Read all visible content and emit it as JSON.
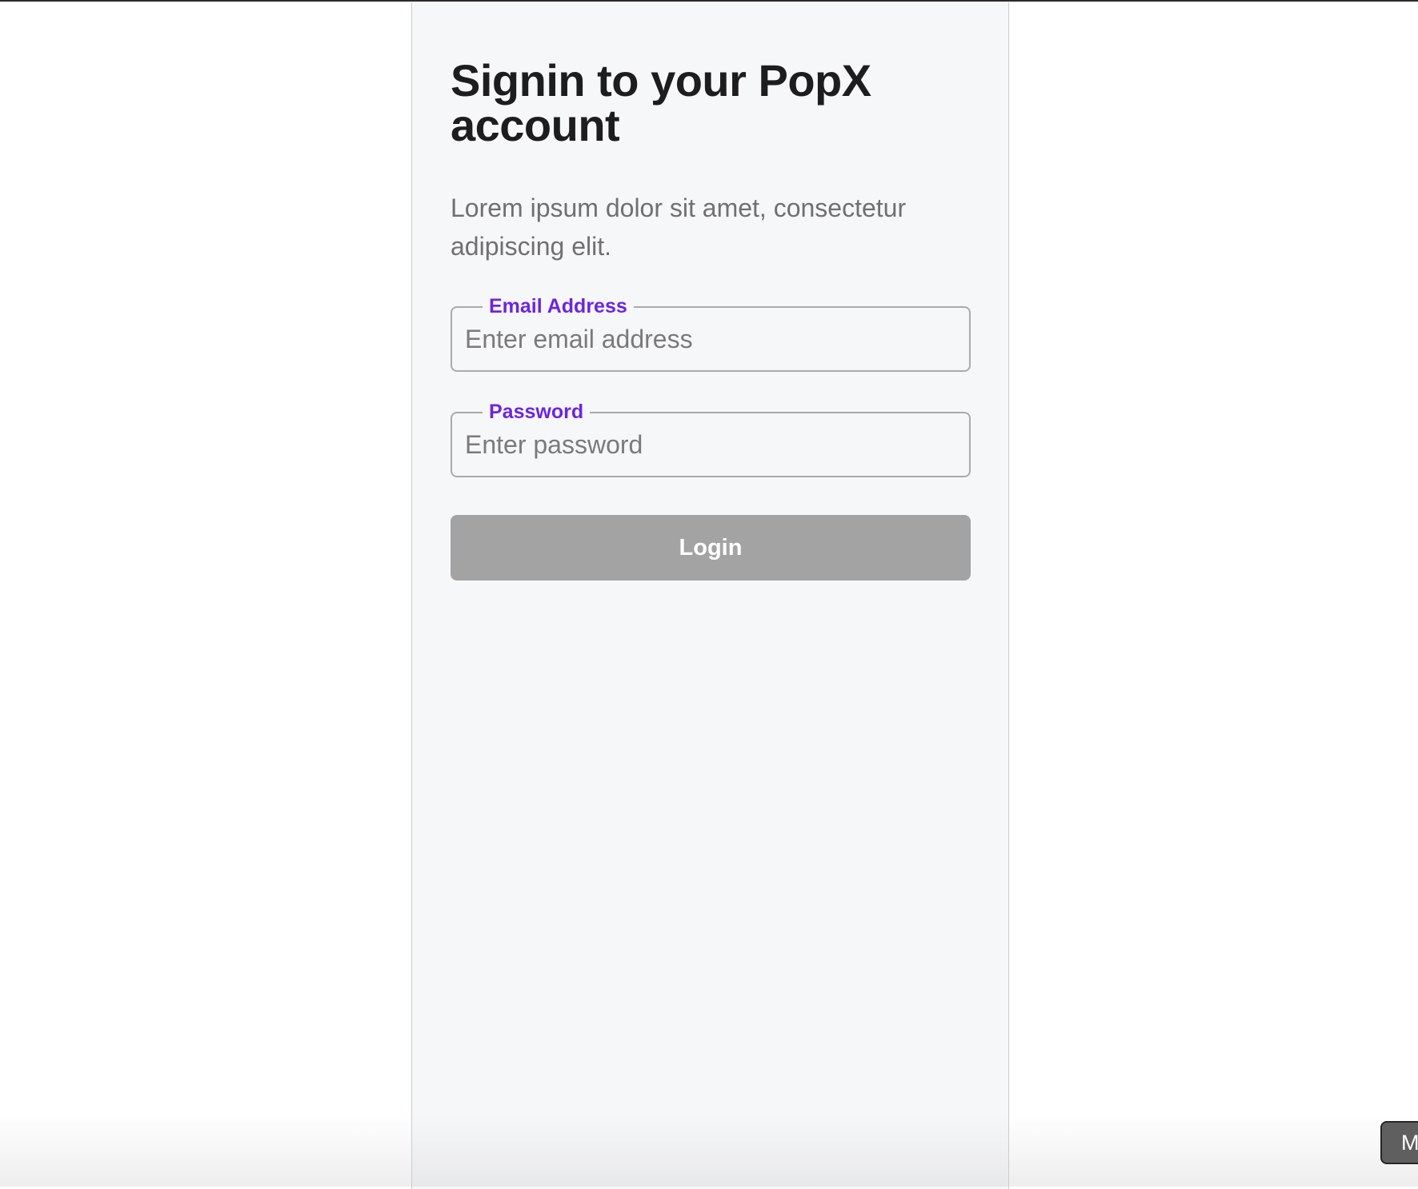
{
  "signin": {
    "title": "Signin to your PopX account",
    "subtitle": "Lorem ipsum dolor sit amet, consectetur adipiscing elit.",
    "email": {
      "label": "Email Address",
      "placeholder": "Enter email address",
      "value": ""
    },
    "password": {
      "label": "Password",
      "placeholder": "Enter password",
      "value": ""
    },
    "login_label": "Login"
  },
  "overlay": {
    "corner_button_label": "M"
  },
  "colors": {
    "accent": "#6C25E2",
    "button_disabled": "#A3A3A3",
    "panel_background": "#F6F7F9"
  }
}
